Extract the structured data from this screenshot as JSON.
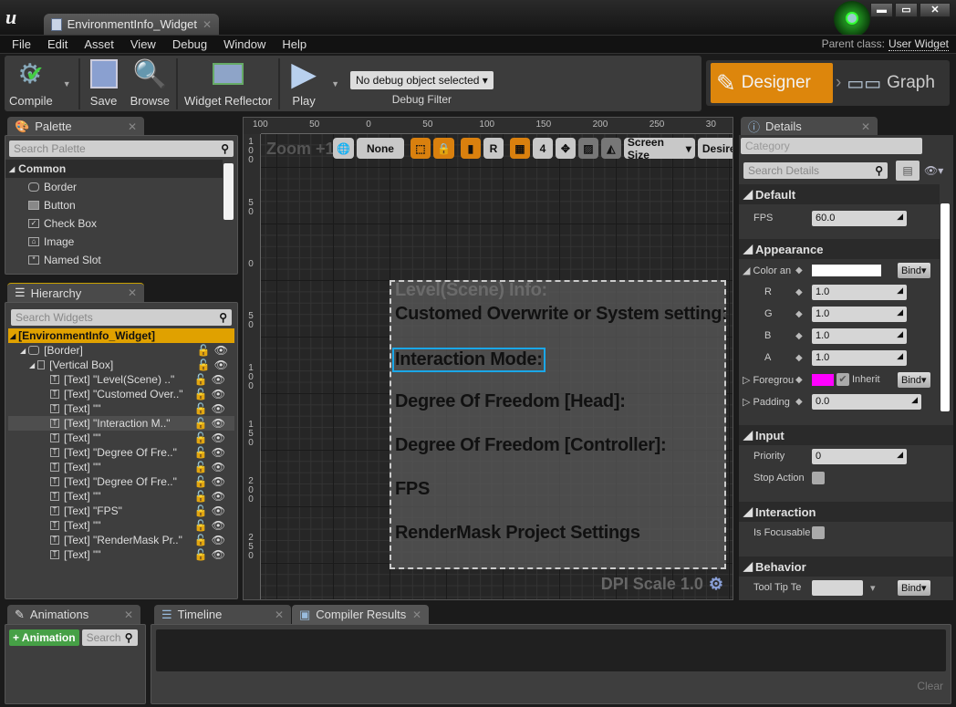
{
  "window": {
    "tab_title": "EnvironmentInfo_Widget",
    "minimize": "▬",
    "maximize": "▭",
    "close": "✕"
  },
  "menu": [
    "File",
    "Edit",
    "Asset",
    "View",
    "Debug",
    "Window",
    "Help"
  ],
  "parent_class": {
    "label": "Parent class:",
    "value": "User Widget"
  },
  "toolbar": {
    "compile": "Compile",
    "save": "Save",
    "browse": "Browse",
    "widget_reflector": "Widget Reflector",
    "play": "Play",
    "debug_object": "No debug object selected",
    "debug_filter": "Debug Filter"
  },
  "modes": {
    "designer": "Designer",
    "graph": "Graph",
    "accent": "#dd860c"
  },
  "palette": {
    "tab": "Palette",
    "search_placeholder": "Search Palette",
    "category": "Common",
    "items": [
      {
        "label": "Border",
        "icon": "border-icon"
      },
      {
        "label": "Button",
        "icon": "button-icon"
      },
      {
        "label": "Check Box",
        "icon": "checkbox-icon"
      },
      {
        "label": "Image",
        "icon": "image-icon"
      },
      {
        "label": "Named Slot",
        "icon": "named-slot-icon"
      }
    ]
  },
  "hierarchy": {
    "tab": "Hierarchy",
    "search_placeholder": "Search Widgets",
    "root": "[EnvironmentInfo_Widget]",
    "border": "[Border]",
    "vbox": "[Vertical Box]",
    "items": [
      "[Text] \"Level(Scene) ..\"",
      "[Text] \"Customed Over..\"",
      "[Text] \"\"",
      "[Text] \"Interaction M..\"",
      "[Text] \"\"",
      "[Text] \"Degree Of Fre..\"",
      "[Text] \"\"",
      "[Text] \"Degree Of Fre..\"",
      "[Text] \"\"",
      "[Text] \"FPS\"",
      "[Text] \"\"",
      "[Text] \"RenderMask Pr..\"",
      "[Text] \"\""
    ],
    "selected_index": 3
  },
  "viewport": {
    "zoom": "Zoom +1",
    "none": "None",
    "r": "R",
    "grid_snap": "4",
    "screen_size": "Screen Size",
    "desired": "Desired",
    "dpi": "DPI Scale 1.0",
    "ruler_top": [
      "100",
      "50",
      "0",
      "50",
      "100",
      "150",
      "200",
      "250",
      "30"
    ],
    "ruler_left": [
      "100",
      "50",
      "0",
      "50",
      "100",
      "150",
      "200",
      "250"
    ],
    "texts": [
      "Level(Scene) Info:",
      "Customed Overwrite or System setting:",
      "Interaction Mode:",
      "Degree Of Freedom [Head]:",
      "Degree Of Freedom [Controller]:",
      "FPS",
      "RenderMask Project Settings"
    ]
  },
  "details": {
    "tab": "Details",
    "category_placeholder": "Category",
    "search_placeholder": "Search Details",
    "default": {
      "title": "Default",
      "fps_label": "FPS",
      "fps": "60.0"
    },
    "appearance": {
      "title": "Appearance",
      "color_label": "Color an",
      "r": "1.0",
      "g": "1.0",
      "b": "1.0",
      "a": "1.0",
      "foreground_label": "Foregrou",
      "inherit": "Inherit",
      "padding_label": "Padding",
      "padding": "0.0",
      "bind": "Bind",
      "color_swatch": "#ffffff",
      "foreground_swatch": "#ff00ff",
      "labels": [
        "R",
        "G",
        "B",
        "A"
      ]
    },
    "input": {
      "title": "Input",
      "priority_label": "Priority",
      "priority": "0",
      "stop_action": "Stop Action"
    },
    "interaction": {
      "title": "Interaction",
      "is_focusable": "Is Focusable"
    },
    "behavior": {
      "title": "Behavior",
      "tooltip": "Tool Tip Te"
    }
  },
  "bottom": {
    "animations_tab": "Animations",
    "add_animation": "+ Animation",
    "search_placeholder": "Search",
    "timeline_tab": "Timeline",
    "compiler_tab": "Compiler Results",
    "clear": "Clear"
  }
}
